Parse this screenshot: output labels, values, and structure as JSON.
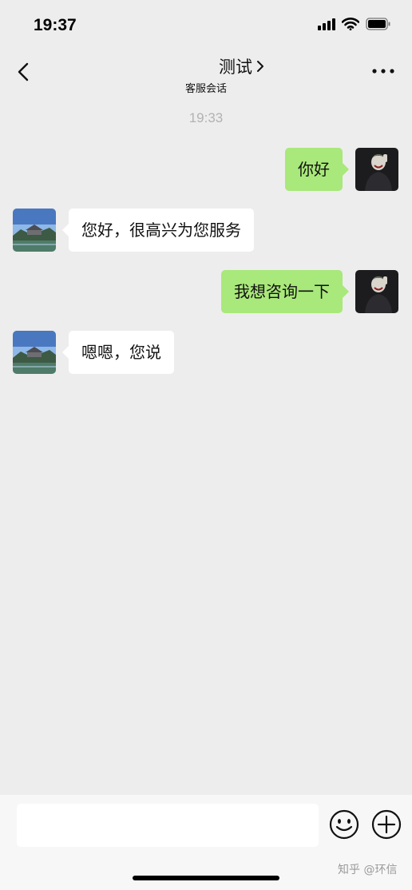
{
  "status_bar": {
    "time": "19:37",
    "icons": [
      "cellular-signal-icon",
      "wifi-icon",
      "battery-icon"
    ]
  },
  "nav": {
    "back_icon": "chevron-left-icon",
    "title": "测试",
    "subtitle": "客服会话",
    "more_icon": "more-dots-icon"
  },
  "chat": {
    "timestamp": "19:33",
    "messages": [
      {
        "direction": "outgoing",
        "text": "你好"
      },
      {
        "direction": "incoming",
        "text": "您好，很高兴为您服务"
      },
      {
        "direction": "outgoing",
        "text": "我想咨询一下"
      },
      {
        "direction": "incoming",
        "text": "嗯嗯，您说"
      }
    ]
  },
  "input_bar": {
    "value": "",
    "emoji_icon": "emoji-icon",
    "plus_icon": "plus-circle-icon"
  },
  "watermark": "知乎 @环信",
  "colors": {
    "background": "#ededed",
    "outgoing_bubble": "#a9e87a",
    "incoming_bubble": "#ffffff",
    "timestamp": "#b2b2b2"
  }
}
